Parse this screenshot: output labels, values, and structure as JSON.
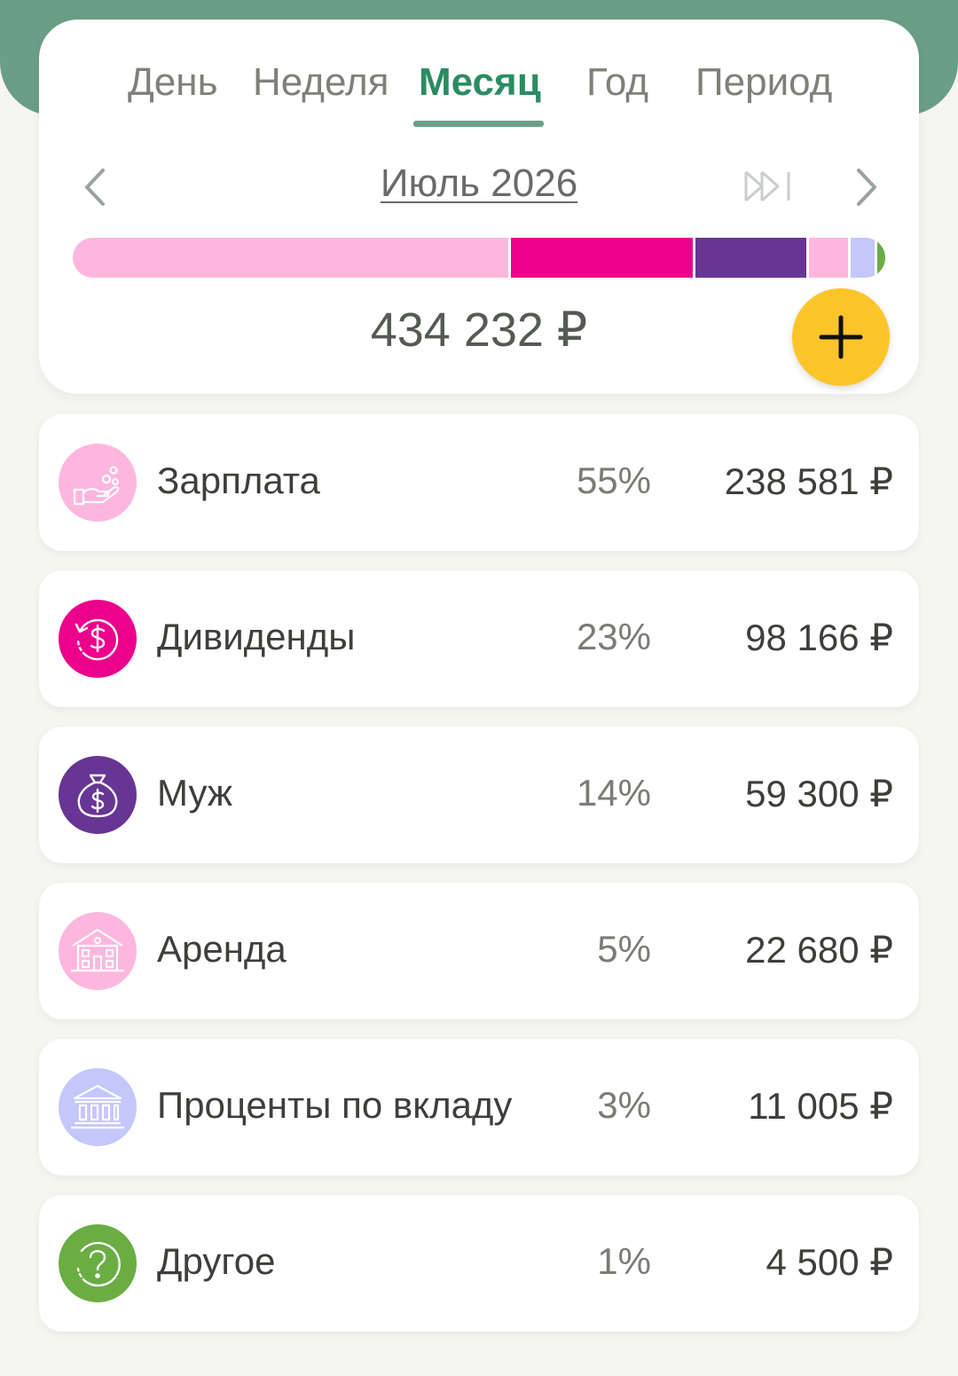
{
  "tabs": [
    "День",
    "Неделя",
    "Месяц",
    "Год",
    "Период"
  ],
  "active_tab": "Месяц",
  "period_label": "Июль 2026",
  "total": "434 232 ₽",
  "colors": {
    "header": "#6a9f86",
    "accent": "#2b8c61",
    "add_button": "#fbc52a"
  },
  "bar": [
    {
      "name": "Зарплата",
      "share": 55,
      "color": "#fdb7df"
    },
    {
      "name": "Дивиденды",
      "share": 23,
      "color": "#ec008c"
    },
    {
      "name": "Муж",
      "share": 14,
      "color": "#673593"
    },
    {
      "name": "Аренда",
      "share": 5,
      "color": "#fdb7df"
    },
    {
      "name": "Проценты по вкладу",
      "share": 3,
      "color": "#c3c7fb"
    },
    {
      "name": "Другое",
      "share": 1,
      "color": "#6aad43"
    }
  ],
  "categories": [
    {
      "name": "Зарплата",
      "percent": "55%",
      "amount": "238 581 ₽",
      "icon": "hand-coins-icon",
      "color": "#fdb7df"
    },
    {
      "name": "Дивиденды",
      "percent": "23%",
      "amount": "98 166 ₽",
      "icon": "dollar-refresh-icon",
      "color": "#ec008c"
    },
    {
      "name": "Муж",
      "percent": "14%",
      "amount": "59 300 ₽",
      "icon": "money-bag-icon",
      "color": "#673593"
    },
    {
      "name": "Аренда",
      "percent": "5%",
      "amount": "22 680 ₽",
      "icon": "house-icon",
      "color": "#fdb7df"
    },
    {
      "name": "Проценты по вкладу",
      "percent": "3%",
      "amount": "11 005 ₽",
      "icon": "bank-icon",
      "color": "#c3c7fb"
    },
    {
      "name": "Другое",
      "percent": "1%",
      "amount": "4 500 ₽",
      "icon": "question-icon",
      "color": "#6aad43"
    }
  ]
}
